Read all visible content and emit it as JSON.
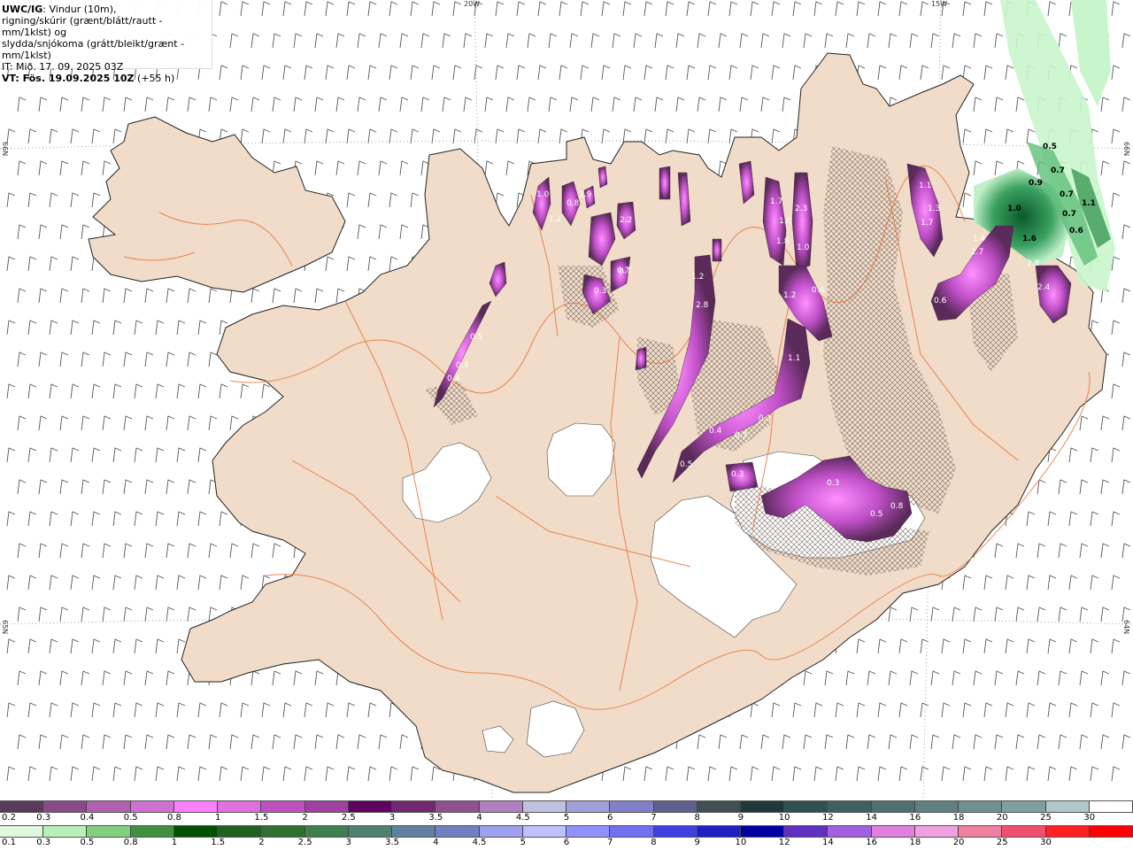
{
  "header": {
    "line1_bold": "UWC/IG",
    "line1_rest": ": Vindur (10m),",
    "line2": "rigning/skúrir (grænt/blátt/rautt - mm/1klst) og",
    "line3": "slydda/snjókoma (grátt/bleikt/grænt - mm/1klst)",
    "line4": "IT: Mið. 17. 09. 2025 03Z",
    "line5_bold": "VT: Fös. 19.09.2025 10Z",
    "line5_rest": " (+55 h)"
  },
  "graticule": {
    "lon_left": "20W",
    "lon_right": "15W",
    "lat_top_left": "66N",
    "lat_top_right": "66N",
    "lat_mid_left": "65N",
    "lat_mid_right": "64N"
  },
  "snow_values": [
    "1.0",
    "0.8",
    "1.9",
    "1.2",
    "1.7",
    "2.3",
    "1.8",
    "1.0",
    "1.2",
    "0.4",
    "1.1",
    "2.8",
    "1.2",
    "0.7",
    "0.3",
    "0.5",
    "0.4",
    "0.4",
    "0.3",
    "0.4",
    "0.3",
    "0.3",
    "0.5",
    "0.3",
    "0.5",
    "0.8",
    "0.6",
    "1.4",
    "2.7",
    "2.8",
    "1.3",
    "1.1",
    "1.7",
    "2.4",
    "1.0",
    "2.2",
    "0.7"
  ],
  "rain_values": [
    "0.5",
    "0.7",
    "0.9",
    "0.7",
    "1.1",
    "0.7",
    "0.6",
    "1.0",
    "1.6"
  ],
  "scale_top": {
    "labels": [
      "0.2",
      "0.3",
      "0.4",
      "0.5",
      "0.8",
      "1",
      "1.5",
      "2",
      "2.5",
      "3",
      "3.5",
      "4",
      "4.5",
      "5",
      "6",
      "7",
      "8",
      "9",
      "10",
      "12",
      "14",
      "16",
      "18",
      "20",
      "25",
      "30"
    ],
    "colors": [
      "#5a3a5a",
      "#8a4a8a",
      "#b060b0",
      "#d070d0",
      "#ff80ff",
      "#e070e0",
      "#c050c0",
      "#a040a0",
      "#600060",
      "#702870",
      "#905090",
      "#b080c0",
      "#c0c0e0",
      "#a0a0d8",
      "#8080c8",
      "#606090",
      "#405050",
      "#203838",
      "#305050",
      "#406060",
      "#507070",
      "#608080",
      "#709090",
      "#80a0a0",
      "#b0c8c8",
      "#ffffff"
    ]
  },
  "scale_bottom": {
    "labels": [
      "0.1",
      "0.3",
      "0.5",
      "0.8",
      "1",
      "1.5",
      "2",
      "2.5",
      "3",
      "3.5",
      "4",
      "4.5",
      "5",
      "6",
      "7",
      "8",
      "9",
      "10",
      "12",
      "14",
      "16",
      "18",
      "20",
      "25",
      "30"
    ],
    "colors": [
      "#e0f8e0",
      "#b8f0b8",
      "#80d080",
      "#409040",
      "#005000",
      "#206020",
      "#307030",
      "#408050",
      "#508070",
      "#6080a0",
      "#7080c0",
      "#a0a0f0",
      "#c0c0ff",
      "#9090ff",
      "#7070f0",
      "#4040e0",
      "#2020c0",
      "#0000a0",
      "#6030c0",
      "#a060e0",
      "#e080e0",
      "#f0a0e0",
      "#f080a0",
      "#f05070",
      "#ff2020",
      "#ff0000"
    ]
  }
}
